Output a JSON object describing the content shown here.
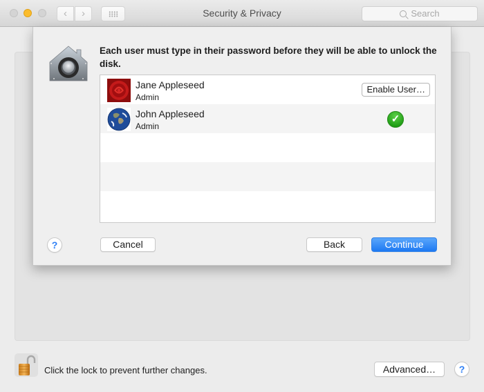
{
  "window": {
    "title": "Security & Privacy",
    "traffic_lights": [
      "close",
      "minimize",
      "zoom"
    ],
    "nav": {
      "back_icon": "chevron-left-icon",
      "forward_icon": "chevron-right-icon",
      "show_all_icon": "grid-icon"
    },
    "search": {
      "placeholder": "Search",
      "value": ""
    }
  },
  "sheet": {
    "icon": "filevault-house-icon",
    "message": "Each user must type in their password before they will be able to unlock the disk.",
    "users": [
      {
        "name": "Jane Appleseed",
        "role": "Admin",
        "avatar": "rose",
        "action_label": "Enable User…",
        "enabled": false
      },
      {
        "name": "John Appleseed",
        "role": "Admin",
        "avatar": "earth",
        "enabled": true
      }
    ],
    "empty_rows": 3,
    "help_label": "?",
    "buttons": {
      "cancel": "Cancel",
      "back": "Back",
      "continue": "Continue"
    }
  },
  "footer": {
    "lock_state": "unlocked",
    "lock_text": "Click the lock to prevent further changes.",
    "advanced_label": "Advanced…",
    "help_label": "?"
  },
  "colors": {
    "accent": "#1d79f2",
    "minimize": "#fbbc2c",
    "check_green": "#1a9a10",
    "help_blue": "#2d7ff5"
  }
}
